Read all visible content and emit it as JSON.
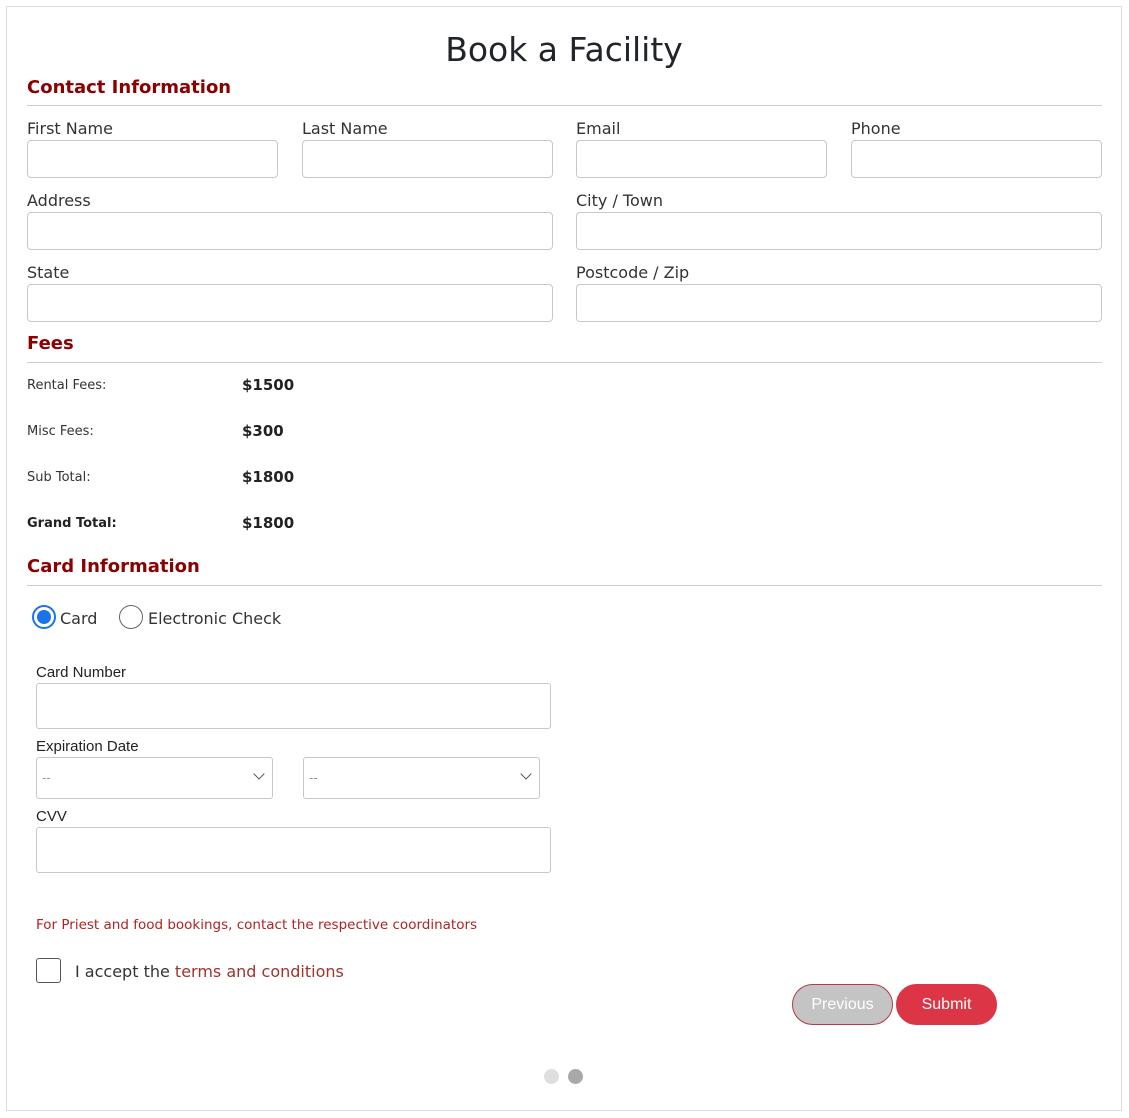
{
  "page": {
    "title": "Book a Facility"
  },
  "contact": {
    "heading": "Contact Information",
    "fields": {
      "first_name": "First Name",
      "last_name": "Last Name",
      "email": "Email",
      "phone": "Phone",
      "address": "Address",
      "city": "City / Town",
      "state": "State",
      "postcode": "Postcode / Zip"
    }
  },
  "fees": {
    "heading": "Fees",
    "rows": [
      {
        "label": "Rental Fees:",
        "value": "$1500"
      },
      {
        "label": "Misc Fees:",
        "value": "$300"
      },
      {
        "label": "Sub Total:",
        "value": "$1800"
      },
      {
        "label": "Grand Total:",
        "value": "$1800"
      }
    ]
  },
  "card_info": {
    "heading": "Card Information",
    "payment_options": [
      {
        "label": "Card",
        "selected": true
      },
      {
        "label": "Electronic Check",
        "selected": false
      }
    ],
    "card_number_label": "Card Number",
    "expiration_label": "Expiration Date",
    "month_select_value": "--",
    "year_select_value": "--",
    "cvv_label": "CVV"
  },
  "notice": "For Priest and food bookings, contact the respective coordinators",
  "terms": {
    "prefix": "I accept the",
    "link_text": "terms and conditions"
  },
  "buttons": {
    "previous": "Previous",
    "submit": "Submit"
  },
  "pagination": {
    "total": 2,
    "active": 2
  },
  "colors": {
    "section_heading": "#8b0000",
    "submit_button": "#dc3545",
    "previous_button": "#c4c4c4",
    "radio_selected": "#1a73e8",
    "notice_text": "#b22222"
  }
}
